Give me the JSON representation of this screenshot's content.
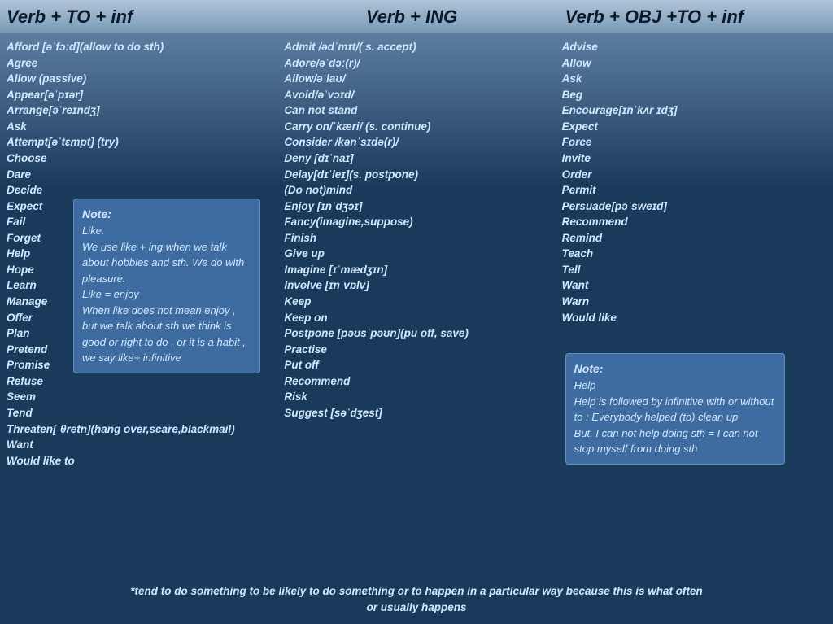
{
  "headers": {
    "col1": "Verb + TO + inf",
    "col2": "Verb + ING",
    "col3": "Verb + OBJ +TO + inf"
  },
  "col1_items": [
    "Afford [əˈfɔːd](allow to do sth)",
    "Agree",
    "Allow (passive)",
    "Appear[əˈpɪər]",
    "Arrange[əˈreɪndʒ]",
    "Ask",
    "Attempt[əˈtɛmpt] (try)",
    "Choose",
    "Dare",
    "Decide",
    "Expect",
    "Fail",
    "Forget",
    "Help",
    "Hope",
    "Learn",
    "Manage",
    "Offer",
    "Plan",
    "Pretend",
    "Promise",
    "Refuse",
    "Seem",
    "Tend",
    "Threaten[ˈθretn](hang over,scare,blackmail)",
    "Want",
    "Would like to"
  ],
  "col1_note": {
    "title": "Note:",
    "line1": "Like.",
    "line2": "We use like + ing when we talk about hobbies and sth. We do with pleasure.",
    "line3": "Like = enjoy",
    "line4": "When like does not mean enjoy , but we talk about sth we think is good or right to do , or it is a habit , we say like+ infinitive"
  },
  "col2_items": [
    "Admit /ədˈmɪt/( s. accept)",
    "Adore/əˈdɔː(r)/",
    "Allow/əˈlaʊ/",
    "Avoid/əˈvɔɪd/",
    "Can not stand",
    "Carry on/ˈkæri/ (s. continue)",
    "Consider /kənˈsɪdə(r)/",
    "Deny [dɪˈnaɪ]",
    "Delay[dɪˈleɪ](s. postpone)",
    "(Do not)mind",
    "Enjoy [ɪnˈdʒɔɪ]",
    "Fancy(imagine,suppose)",
    "Finish",
    "Give up",
    "Imagine [ɪˈmædʒɪn]",
    "Involve [ɪnˈvɒlv]",
    "Keep",
    "Keep on",
    "Postpone [pəʊsˈpəʊn](pu off, save)",
    "Practise",
    "Put off",
    "Recommend",
    "Risk",
    "Suggest [səˈdʒest]"
  ],
  "col3_items": [
    "Advise",
    "Allow",
    "Ask",
    "Beg",
    "Encourage[ɪnˈkʌr ɪdʒ]",
    "Expect",
    "Force",
    "Invite",
    "Order",
    "Permit",
    "Persuade[pəˈsweɪd]",
    "Recommend",
    "Remind",
    "Teach",
    "Tell",
    "Want",
    "Warn",
    "Would like"
  ],
  "col3_note": {
    "title": "Note:",
    "line1": "Help",
    "line2": "Help is followed by infinitive with or without to : Everybody helped (to) clean up",
    "line3": "But, I can not help doing sth = I can not stop myself from doing sth"
  },
  "footer": "*tend to do something to be likely to do something or to happen in a particular way because this is what often or usually happens"
}
